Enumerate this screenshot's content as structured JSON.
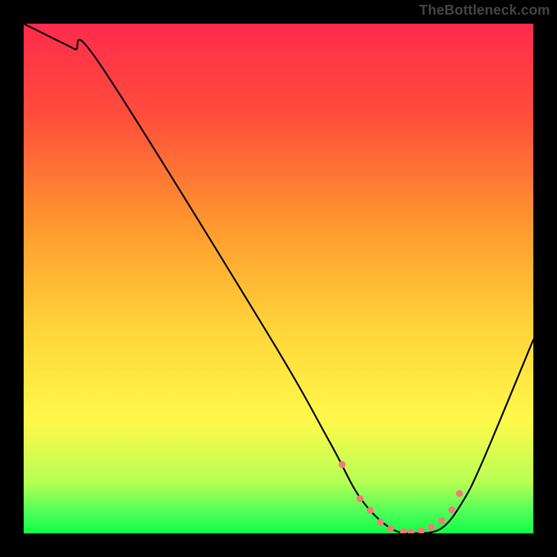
{
  "watermark": "TheBottleneck.com",
  "chart_data": {
    "type": "line",
    "title": "",
    "xlabel": "",
    "ylabel": "",
    "xlim": [
      0,
      100
    ],
    "ylim": [
      0,
      100
    ],
    "gradient_stops": [
      {
        "offset": 0,
        "color": "#ff2a4d"
      },
      {
        "offset": 0.18,
        "color": "#ff4d3c"
      },
      {
        "offset": 0.4,
        "color": "#ff9a2e"
      },
      {
        "offset": 0.6,
        "color": "#ffd53a"
      },
      {
        "offset": 0.78,
        "color": "#fff94a"
      },
      {
        "offset": 0.9,
        "color": "#b6ff54"
      },
      {
        "offset": 0.96,
        "color": "#4bff58"
      },
      {
        "offset": 1.0,
        "color": "#10ff46"
      }
    ],
    "series": [
      {
        "name": "bottleneck-curve",
        "x": [
          0,
          6,
          10,
          15,
          48,
          60,
          66,
          72,
          77,
          82,
          86,
          90,
          100
        ],
        "y": [
          100,
          97,
          95,
          92,
          39,
          18,
          7,
          1,
          0,
          1,
          6,
          14,
          38
        ]
      }
    ],
    "markers": {
      "name": "marker-dots",
      "color": "#ef7b7b",
      "radius": 5,
      "x": [
        62.5,
        66,
        68,
        70,
        72,
        74.5,
        76,
        78,
        80,
        82,
        84,
        85.5
      ],
      "y": [
        13.5,
        6.8,
        4.5,
        2.2,
        0.9,
        0.3,
        0.2,
        0.5,
        1.2,
        2.5,
        4.6,
        7.8
      ]
    }
  }
}
